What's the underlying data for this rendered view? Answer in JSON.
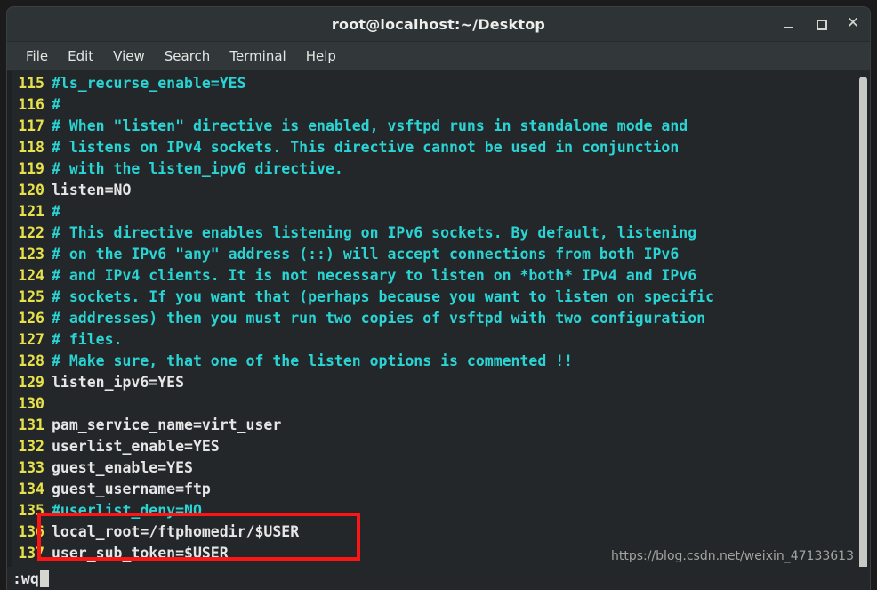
{
  "window": {
    "title": "root@localhost:~/Desktop",
    "controls": [
      {
        "name": "minimize-button",
        "glyph": ""
      },
      {
        "name": "maximize-button",
        "glyph": ""
      },
      {
        "name": "close-button",
        "glyph": "✕"
      }
    ]
  },
  "menubar": {
    "items": [
      "File",
      "Edit",
      "View",
      "Search",
      "Terminal",
      "Help"
    ]
  },
  "editor": {
    "lines": [
      {
        "n": "115",
        "text": "#ls_recurse_enable=YES",
        "comment": true
      },
      {
        "n": "116",
        "text": "#",
        "comment": true
      },
      {
        "n": "117",
        "text": "# When \"listen\" directive is enabled, vsftpd runs in standalone mode and",
        "comment": true
      },
      {
        "n": "118",
        "text": "# listens on IPv4 sockets. This directive cannot be used in conjunction",
        "comment": true
      },
      {
        "n": "119",
        "text": "# with the listen_ipv6 directive.",
        "comment": true
      },
      {
        "n": "120",
        "text": "listen=NO",
        "comment": false
      },
      {
        "n": "121",
        "text": "#",
        "comment": true
      },
      {
        "n": "122",
        "text": "# This directive enables listening on IPv6 sockets. By default, listening",
        "comment": true
      },
      {
        "n": "123",
        "text": "# on the IPv6 \"any\" address (::) will accept connections from both IPv6",
        "comment": true
      },
      {
        "n": "124",
        "text": "# and IPv4 clients. It is not necessary to listen on *both* IPv4 and IPv6",
        "comment": true
      },
      {
        "n": "125",
        "text": "# sockets. If you want that (perhaps because you want to listen on specific",
        "comment": true
      },
      {
        "n": "126",
        "text": "# addresses) then you must run two copies of vsftpd with two configuration",
        "comment": true
      },
      {
        "n": "127",
        "text": "# files.",
        "comment": true
      },
      {
        "n": "128",
        "text": "# Make sure, that one of the listen options is commented !!",
        "comment": true
      },
      {
        "n": "129",
        "text": "listen_ipv6=YES",
        "comment": false
      },
      {
        "n": "130",
        "text": "",
        "comment": false
      },
      {
        "n": "131",
        "text": "pam_service_name=virt_user",
        "comment": false
      },
      {
        "n": "132",
        "text": "userlist_enable=YES",
        "comment": false
      },
      {
        "n": "133",
        "text": "guest_enable=YES",
        "comment": false
      },
      {
        "n": "134",
        "text": "guest_username=ftp",
        "comment": false
      },
      {
        "n": "135",
        "text": "#userlist_deny=NO",
        "comment": true
      },
      {
        "n": "136",
        "text": "local_root=/ftphomedir/$USER",
        "comment": false
      },
      {
        "n": "137",
        "text": "user_sub_token=$USER",
        "comment": false
      }
    ]
  },
  "statusline": {
    "command": ":wq"
  },
  "annotation": {
    "color": "#fd1515",
    "highlights": [
      "136",
      "137"
    ]
  },
  "watermark": {
    "text": "https://blog.csdn.net/weixin_47133613"
  },
  "colors": {
    "line_number": "#e7e14c",
    "comment": "#2ad4d4",
    "code": "#e6e6e6",
    "terminal_bg": "#232729",
    "titlebar_bg": "#2e3436",
    "menubar_bg": "#32383a",
    "desktop_bg": "#11417e"
  }
}
